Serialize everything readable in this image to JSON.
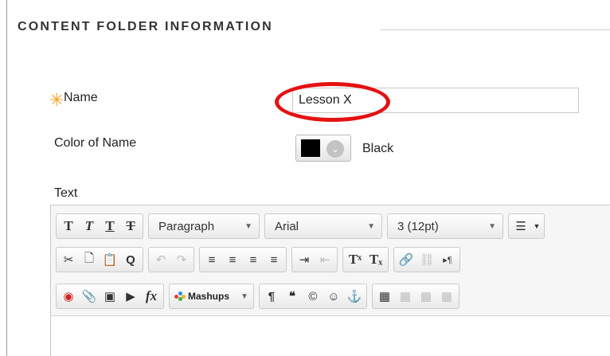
{
  "section": {
    "title": "CONTENT FOLDER INFORMATION"
  },
  "name_field": {
    "label": "Name",
    "value": "Lesson X",
    "required": true,
    "required_symbol": "✳"
  },
  "color_field": {
    "label": "Color of Name",
    "selected_color_name": "Black",
    "selected_color": "#000000"
  },
  "text_field": {
    "label": "Text"
  },
  "toolbar": {
    "row1": {
      "paragraph_format": "Paragraph",
      "font_family": "Arial",
      "font_size": "3 (12pt)"
    },
    "row3": {
      "mashups_label": "Mashups"
    }
  },
  "colors": {
    "required_star": "#f0a31c",
    "highlight_circle": "#e41212",
    "section_title": "#333333"
  }
}
